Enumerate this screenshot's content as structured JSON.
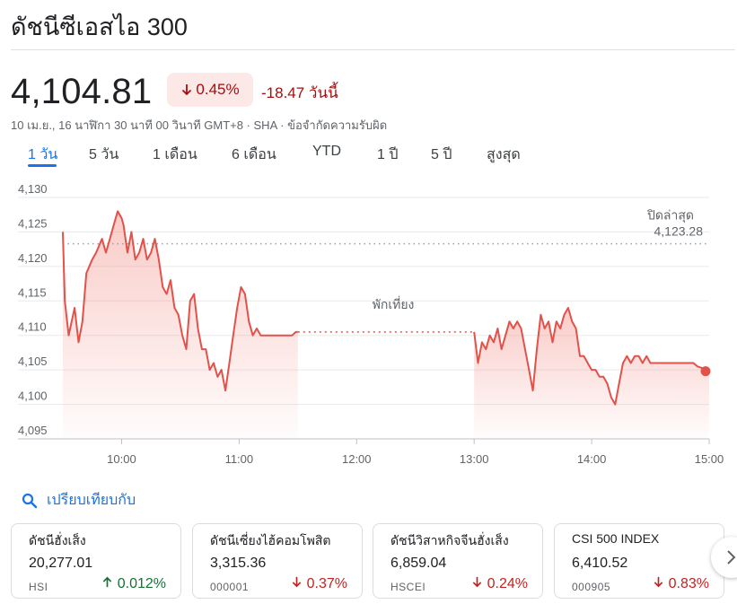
{
  "header": {
    "title": "ดัชนีซีเอสไอ 300"
  },
  "quote": {
    "price": "4,104.81",
    "change_pct": "0.45%",
    "change_abs": "-18.47 วันนี้",
    "subline": "10 เม.ย., 16 นาฬิกา 30 นาที 00 วินาที GMT+8 · SHA · ข้อจำกัดความรับผิด",
    "color_down": "#c5221f",
    "color_up": "#137333",
    "accent": "#1a73e8"
  },
  "tabs": [
    {
      "label": "1 วัน",
      "active": true
    },
    {
      "label": "5 วัน"
    },
    {
      "label": "1 เดือน"
    },
    {
      "label": "6 เดือน"
    },
    {
      "label": "YTD"
    },
    {
      "label": "1 ปี"
    },
    {
      "label": "5 ปี"
    },
    {
      "label": "สูงสุด"
    }
  ],
  "chart_data": {
    "type": "line",
    "ylim": [
      4095,
      4130
    ],
    "y_ticks": [
      "4,130",
      "4,125",
      "4,120",
      "4,115",
      "4,110",
      "4,105",
      "4,100",
      "4,095"
    ],
    "x_ticks": [
      "10:00",
      "11:00",
      "12:00",
      "13:00",
      "14:00",
      "15:00"
    ],
    "x_tick_hours": [
      10,
      11,
      12,
      13,
      14,
      15
    ],
    "xlim_hours": [
      9.5,
      15
    ],
    "previous_close": {
      "label": "ปิดล่าสุด",
      "value_label": "4,123.28",
      "value": 4123.28
    },
    "lunch_break": {
      "label": "พักเที่ยง",
      "start": "11:30",
      "end": "13:00",
      "level": 4110.5
    },
    "line_color": "#e2514a",
    "series_morning": {
      "x": [
        "09:30",
        "09:31",
        "09:33",
        "09:36",
        "09:38",
        "09:40",
        "09:42",
        "09:45",
        "09:47",
        "09:50",
        "09:52",
        "09:54",
        "09:56",
        "09:58",
        "10:00",
        "10:01",
        "10:02",
        "10:03",
        "10:05",
        "10:07",
        "10:09",
        "10:11",
        "10:13",
        "10:15",
        "10:17",
        "10:19",
        "10:21",
        "10:23",
        "10:25",
        "10:27",
        "10:29",
        "10:31",
        "10:33",
        "10:35",
        "10:37",
        "10:39",
        "10:41",
        "10:43",
        "10:45",
        "10:47",
        "10:49",
        "10:51",
        "10:53",
        "10:55",
        "10:57",
        "10:59",
        "11:01",
        "11:03",
        "11:05",
        "11:07",
        "11:09",
        "11:11",
        "11:13",
        "11:15",
        "11:17",
        "11:19",
        "11:21",
        "11:23",
        "11:25",
        "11:27",
        "11:29",
        "11:30"
      ],
      "y": [
        4125,
        4115,
        4110,
        4114,
        4109,
        4112,
        4119,
        4121,
        4122,
        4124,
        4122,
        4124,
        4126,
        4128,
        4127,
        4126,
        4124,
        4122,
        4125,
        4121,
        4122,
        4124,
        4121,
        4122,
        4124,
        4121,
        4117,
        4116,
        4118,
        4114,
        4113,
        4110,
        4108,
        4115,
        4116,
        4111,
        4108,
        4108,
        4105,
        4106,
        4104,
        4105,
        4102,
        4106,
        4110,
        4114,
        4117,
        4116,
        4112,
        4110,
        4111,
        4110,
        4110,
        4110,
        4110,
        4110,
        4110,
        4110,
        4110,
        4110,
        4110.5,
        4110.5
      ]
    },
    "series_afternoon": {
      "x": [
        "13:00",
        "13:02",
        "13:04",
        "13:06",
        "13:08",
        "13:10",
        "13:12",
        "13:14",
        "13:16",
        "13:18",
        "13:20",
        "13:22",
        "13:24",
        "13:26",
        "13:28",
        "13:30",
        "13:32",
        "13:34",
        "13:36",
        "13:38",
        "13:40",
        "13:42",
        "13:44",
        "13:46",
        "13:48",
        "13:50",
        "13:52",
        "13:54",
        "13:56",
        "13:58",
        "14:00",
        "14:02",
        "14:04",
        "14:06",
        "14:08",
        "14:10",
        "14:12",
        "14:14",
        "14:16",
        "14:18",
        "14:20",
        "14:22",
        "14:24",
        "14:26",
        "14:28",
        "14:30",
        "14:32",
        "14:34",
        "14:36",
        "14:38",
        "14:40",
        "14:42",
        "14:44",
        "14:46",
        "14:48",
        "14:50",
        "14:52",
        "14:54",
        "14:56",
        "14:58",
        "15:00"
      ],
      "y": [
        4110.5,
        4106,
        4109,
        4108,
        4110,
        4109,
        4111,
        4108,
        4110,
        4112,
        4111,
        4112,
        4111,
        4108,
        4105,
        4102,
        4108,
        4113,
        4111,
        4112,
        4109,
        4112,
        4111,
        4113,
        4114,
        4112,
        4111,
        4107,
        4107,
        4106,
        4105,
        4105,
        4104,
        4104,
        4103,
        4101,
        4100,
        4103,
        4106,
        4107,
        4106,
        4107,
        4107,
        4106,
        4107,
        4106,
        4106,
        4106,
        4106,
        4106,
        4106,
        4106,
        4106,
        4106,
        4106,
        4106,
        4106,
        4105.5,
        4105.3,
        4105.1,
        4104.81
      ]
    }
  },
  "compare": {
    "label": "เปรียบเทียบกับ"
  },
  "cards": [
    {
      "name": "ดัชนีฮั่งเส็ง",
      "value": "20,277.01",
      "symbol": "HSI",
      "pct": "0.012%",
      "direction": "up"
    },
    {
      "name": "ดัชนีเซี่ยงไฮ้คอมโพสิต",
      "value": "3,315.36",
      "symbol": "000001",
      "pct": "0.37%",
      "direction": "down"
    },
    {
      "name": "ดัชนีวิสาหกิจจีนฮั่งเส็ง",
      "value": "6,859.04",
      "symbol": "HSCEI",
      "pct": "0.24%",
      "direction": "down"
    },
    {
      "name": "CSI 500 INDEX",
      "value": "6,410.52",
      "symbol": "000905",
      "pct": "0.83%",
      "direction": "down"
    }
  ]
}
